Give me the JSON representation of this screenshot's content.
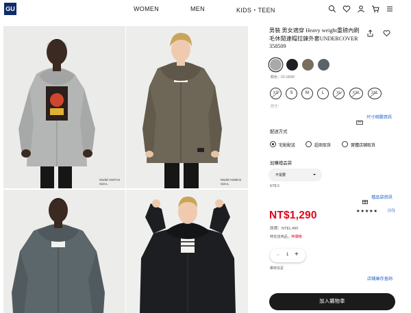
{
  "header": {
    "logo": "GU",
    "nav": [
      "WOMEN",
      "MEN",
      "KIDS・TEEN"
    ],
    "icons": [
      "search-icon",
      "heart-icon",
      "user-icon",
      "cart-icon",
      "menu-icon"
    ]
  },
  "gallery": {
    "photos": [
      {
        "caption": "Model:H187cm\nSize:L"
      },
      {
        "caption": "Model:H188cm\nSize:L"
      },
      {
        "caption": ""
      },
      {
        "caption": ""
      }
    ]
  },
  "product": {
    "title": "男裝 男女適穿 Heavy weight重磅內刷毛休閒連帽拉鍊外套UNDERCOVER 358509",
    "share_icon": "share-icon",
    "favorite_icon": "heart-icon",
    "colors": [
      {
        "name": "gray",
        "hex": "#a9aaa8"
      },
      {
        "name": "black",
        "hex": "#1f2024"
      },
      {
        "name": "olive",
        "hex": "#7a6e5e"
      },
      {
        "name": "slate",
        "hex": "#5a6468"
      }
    ],
    "color_label": "顏色：03 GRAY",
    "sizes": [
      "XS",
      "S",
      "M",
      "L",
      "XL",
      "XXL",
      "3XL"
    ],
    "sizes_unavailable": [
      "XS",
      "XL",
      "XXL",
      "3XL"
    ],
    "size_label": "尺寸：",
    "size_chart_link": "尺寸相關資訊",
    "delivery_title": "配送方式",
    "delivery_options": [
      "宅配配送",
      "超商取貨",
      "實體店鋪取貨"
    ],
    "delivery_selected": 0,
    "gift_bag_title": "加購禮品袋",
    "gift_bag_value": "不需要",
    "gift_bag_price": "NT$ 0",
    "gift_bag_link": "禮品袋資訊",
    "price": "NT$1,290",
    "rating_stars": 4.5,
    "stars_text": "★★★★★",
    "review_count": "(10)",
    "original_price": "原價：NT$1,490",
    "promo_prefix": "特定店商品，",
    "promo_highlight": "熱價格",
    "quantity": "1",
    "quantity_minus": "−",
    "quantity_plus": "+",
    "stock_label": "庫存充足",
    "store_stock_link": "店鋪庫存查詢",
    "add_to_cart": "加入購物車"
  },
  "colors": {
    "accent_red": "#e2001a",
    "link_blue": "#2466c8",
    "logo_navy": "#0e2b6b",
    "button_dark": "#1b1b1b"
  }
}
